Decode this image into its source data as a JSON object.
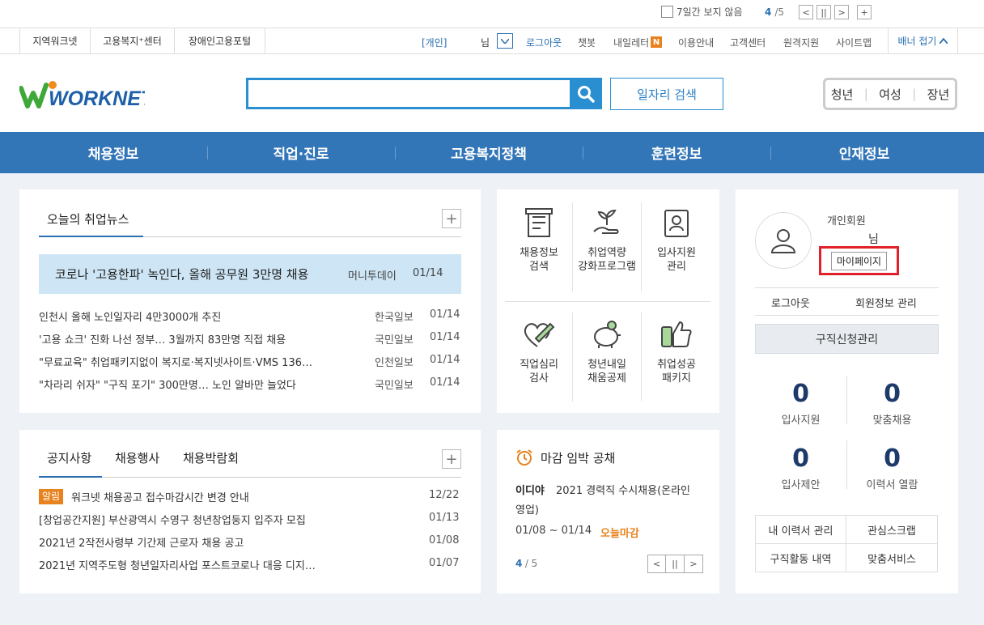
{
  "topbar": {
    "hide7_label": "7일간 보지 않음",
    "pager_current": "4",
    "pager_total": "/5"
  },
  "util_nav": {
    "left_links": [
      "지역워크넷",
      "고용복지⁺센터",
      "장애인고용포털"
    ],
    "user_type": "[개인]",
    "user_suffix": "님",
    "logout": "로그아웃",
    "chatbot": "챗봇",
    "my_letter": "내일레터",
    "my_letter_badge": "N",
    "guide": "이용안내",
    "customer": "고객센터",
    "remote": "원격지원",
    "sitemap": "사이트맵",
    "banner_fold": "배너 접기"
  },
  "header": {
    "logo_text": "WORKNET",
    "search_placeholder": "",
    "job_search_label": "일자리 검색",
    "quick": [
      "청년",
      "여성",
      "장년"
    ]
  },
  "main_nav": [
    "채용정보",
    "직업·진로",
    "고용복지정책",
    "훈련정보",
    "인재정보"
  ],
  "news": {
    "title": "오늘의 취업뉴스",
    "headline": {
      "title": "코로나 '고용한파' 녹인다, 올해 공무원 3만명 채용",
      "source": "머니투데이",
      "date": "01/14"
    },
    "items": [
      {
        "title": "인천시 올해 노인일자리 4만3000개 추진",
        "source": "한국일보",
        "date": "01/14"
      },
      {
        "title": "'고용 쇼크' 진화 나선 정부… 3월까지 83만명 직접 채용",
        "source": "국민일보",
        "date": "01/14"
      },
      {
        "title": "\"무료교육\" 취업패키지없이 복지로·복지넷사이트·VMS 136…",
        "source": "인천일보",
        "date": "01/14"
      },
      {
        "title": "\"차라리 쉬자\" \"구직 포기\" 300만명… 노인 알바만 늘었다",
        "source": "국민일보",
        "date": "01/14"
      }
    ]
  },
  "notice": {
    "tabs": [
      "공지사항",
      "채용행사",
      "채용박람회"
    ],
    "items": [
      {
        "badge": "알림",
        "title": "워크넷 채용공고 접수마감시간 변경 안내",
        "date": "12/22"
      },
      {
        "badge": "",
        "title": "[창업공간지원] 부산광역시 수영구 청년창업둥지 입주자 모집",
        "date": "01/13"
      },
      {
        "badge": "",
        "title": "2021년 2작전사령부 기간제 근로자 채용 공고",
        "date": "01/08"
      },
      {
        "badge": "",
        "title": "2021년 지역주도형 청년일자리사업 포스트코로나 대응 디지…",
        "date": "01/07"
      }
    ]
  },
  "services": [
    {
      "line1": "채용정보",
      "line2": "검색",
      "icon": "document-icon"
    },
    {
      "line1": "취업역량",
      "line2": "강화프로그램",
      "icon": "plant-hand-icon"
    },
    {
      "line1": "입사지원",
      "line2": "관리",
      "icon": "id-card-icon"
    },
    {
      "line1": "직업심리",
      "line2": "검사",
      "icon": "heart-pen-icon"
    },
    {
      "line1": "청년내일",
      "line2": "채움공제",
      "icon": "piggy-bank-icon"
    },
    {
      "line1": "취업성공",
      "line2": "패키지",
      "icon": "thumbs-up-icon"
    }
  ],
  "deadline": {
    "title": "마감 임박 공채",
    "company": "이디야",
    "desc": "2021 경력직 수시채용(온라인",
    "desc2": "영업)",
    "period": "01/08 ~ 01/14",
    "today": "오늘마감",
    "pager_current": "4",
    "pager_total": " / 5"
  },
  "member": {
    "type": "개인회원",
    "suffix": "님",
    "mypage": "마이페이지",
    "logout": "로그아웃",
    "edit": "회원정보 관리",
    "job_apply_mgmt": "구직신청관리",
    "stats": [
      {
        "value": "0",
        "label": "입사지원"
      },
      {
        "value": "0",
        "label": "맞춤채용"
      },
      {
        "value": "0",
        "label": "입사제안"
      },
      {
        "value": "0",
        "label": "이력서 열람"
      }
    ],
    "links": [
      "내 이력서 관리",
      "관심스크랩",
      "구직활동 내역",
      "맞춤서비스"
    ]
  },
  "colors": {
    "brand_blue": "#3376b8",
    "highlight_red": "#e0202a",
    "orange": "#e8821e",
    "green": "#3a9a3a"
  }
}
